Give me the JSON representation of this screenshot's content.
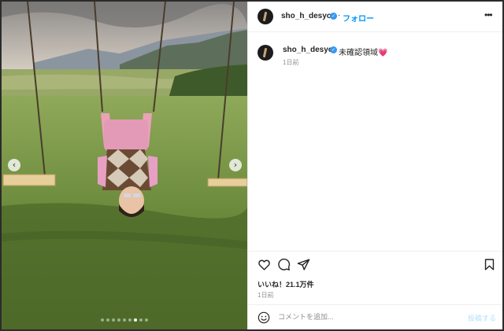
{
  "post": {
    "username": "sho_h_desyo",
    "verified_glyph": "✓",
    "follow_label": "フォロー",
    "more_glyph": "•••",
    "caption": "未確認領域💗",
    "caption_time": "1日前",
    "likes": "いいね！21.1万件",
    "post_time": "1日前"
  },
  "media": {
    "prev_glyph": "‹",
    "next_glyph": "›",
    "carousel_dots": 9,
    "active_dot": 6
  },
  "comment_box": {
    "placeholder": "コメントを追加...",
    "post_label": "投稿する"
  },
  "icons": [
    "heart-icon",
    "comment-icon",
    "share-icon",
    "bookmark-icon",
    "emoji-icon",
    "more-icon",
    "verified-icon"
  ],
  "colors": {
    "accent": "#0095f6",
    "verified": "#3897f0",
    "muted": "#8e8e8e",
    "post_disabled": "#b2dffc"
  }
}
